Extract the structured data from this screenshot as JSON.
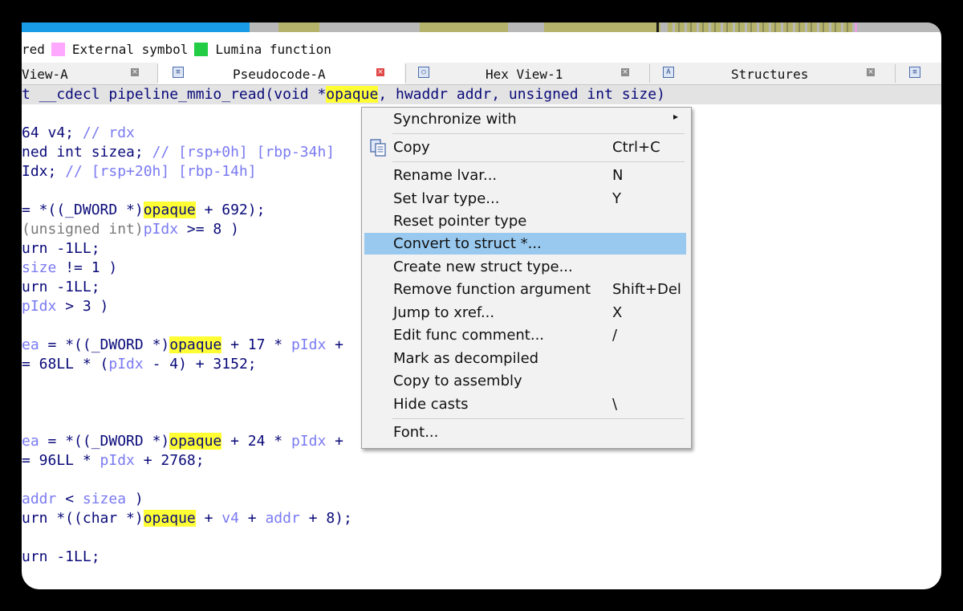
{
  "legend": {
    "partial_text": "red",
    "items": [
      {
        "label": "External symbol",
        "color": "#ffa8ff"
      },
      {
        "label": "Lumina function",
        "color": "#22cc44"
      }
    ]
  },
  "tabs": [
    {
      "label": "View-A",
      "active": false
    },
    {
      "label": "Pseudocode-A",
      "active": true
    },
    {
      "label": "Hex View-1",
      "active": false
    },
    {
      "label": "Structures",
      "active": false
    }
  ],
  "code": {
    "signature": [
      "t __cdecl pipeline_mmio_read(void *",
      "opaque",
      ", hwaddr addr, unsigned int size)"
    ],
    "lines": {
      "l1a": "64 v4; ",
      "l1b": "// rdx",
      "l2a": "ned int sizea; ",
      "l2b": "// [rsp+0h] [rbp-34h]",
      "l3a": "Idx; ",
      "l3b": "// [rsp+20h] [rbp-14h]",
      "l4a": "= *((_DWORD *)",
      "l4h": "opaque",
      "l4b": " + 692);",
      "l5a": "(unsigned int)",
      "l5b": "pIdx",
      "l5c": " >= 8 )",
      "l6": "urn -1LL;",
      "l7a": "size",
      "l7b": " != 1 )",
      "l8": "urn -1LL;",
      "l9a": "pIdx",
      "l9b": " > 3 )",
      "l10a": "ea",
      "l10b": " = *((_DWORD *)",
      "l10h": "opaque",
      "l10c": " + 17 * ",
      "l10d": "pIdx",
      "l10e": " + ",
      "l11a": "= 68LL * (",
      "l11b": "pIdx",
      "l11c": " - 4) + 3152;",
      "l12a": "ea",
      "l12b": " = *((_DWORD *)",
      "l12h": "opaque",
      "l12c": " + 24 * ",
      "l12d": "pIdx",
      "l12e": " + ",
      "l13a": "= 96LL * ",
      "l13b": "pIdx",
      "l13c": " + 2768;",
      "l14a": "addr",
      "l14b": " < ",
      "l14c": "sizea",
      "l14d": " )",
      "l15a": "urn *((char *)",
      "l15h": "opaque",
      "l15b": " + ",
      "l15c": "v4",
      "l15d": " + ",
      "l15e": "addr",
      "l15f": " + 8);",
      "l16": "urn -1LL;"
    }
  },
  "context_menu": {
    "items": [
      {
        "label": "Synchronize with",
        "shortcut": "",
        "submenu": true
      },
      {
        "label": "Copy",
        "shortcut": "Ctrl+C",
        "icon": "copy-icon"
      },
      {
        "label": "Rename lvar...",
        "shortcut": "N"
      },
      {
        "label": "Set lvar type...",
        "shortcut": "Y"
      },
      {
        "label": "Reset pointer type",
        "shortcut": ""
      },
      {
        "label": "Convert to struct *...",
        "shortcut": "",
        "selected": true
      },
      {
        "label": "Create new struct type...",
        "shortcut": ""
      },
      {
        "label": "Remove function argument",
        "shortcut": "Shift+Del"
      },
      {
        "label": "Jump to xref...",
        "shortcut": "X"
      },
      {
        "label": "Edit func comment...",
        "shortcut": "/"
      },
      {
        "label": "Mark as decompiled",
        "shortcut": ""
      },
      {
        "label": "Copy to assembly",
        "shortcut": ""
      },
      {
        "label": "Hide casts",
        "shortcut": "\\"
      },
      {
        "label": "Font...",
        "shortcut": ""
      }
    ]
  },
  "colors": {
    "highlight": "#ffff33",
    "selection": "#99c9ef",
    "code_text": "#0a0a7a",
    "code_var": "#7a7af2"
  }
}
